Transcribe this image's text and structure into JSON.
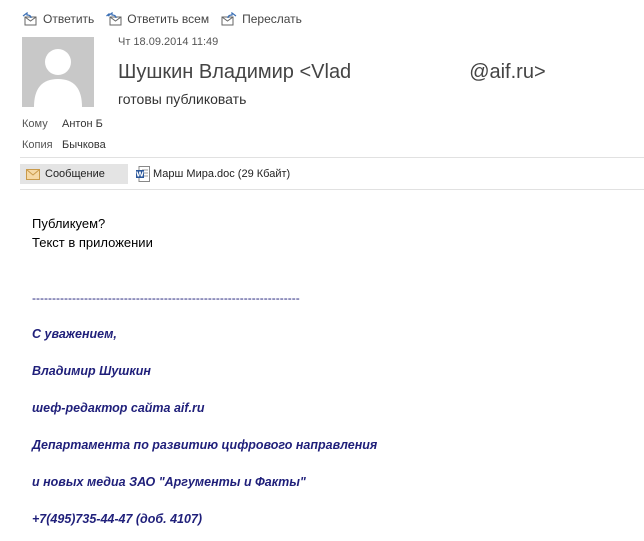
{
  "toolbar": {
    "reply_label": "Ответить",
    "reply_all_label": "Ответить всем",
    "forward_label": "Переслать"
  },
  "header": {
    "date": "Чт 18.09.2014 11:49",
    "sender_name": "Шушкин Владимир <Vlad",
    "sender_domain": "@aif.ru>",
    "subject": "готовы публиковать",
    "to_label": "Кому",
    "to_value": "Антон Б",
    "cc_label": "Копия",
    "cc_value": "Бычкова Ека"
  },
  "attachments": {
    "message_tab": "Сообщение",
    "file_name": "Марш Мира.doc (29 Кбайт)"
  },
  "body": {
    "line1": "Публикуем?",
    "line2": "Текст в приложении"
  },
  "signature": {
    "separator": "-------------------------------------------------------------------",
    "regards": "С уважением,",
    "name": "Владимир Шушкин",
    "position": "шеф-редактор сайта aif.ru",
    "department": "Департамента по развитию цифрового направления",
    "company": "и новых медиа ЗАО \"Аргументы и Факты\"",
    "phone": "+7(495)735-44-47 (доб. 4107)"
  },
  "icons": {
    "reply": "reply-icon",
    "reply_all": "reply-all-icon",
    "forward": "forward-icon",
    "message": "envelope-icon",
    "word": "word-doc-icon"
  }
}
